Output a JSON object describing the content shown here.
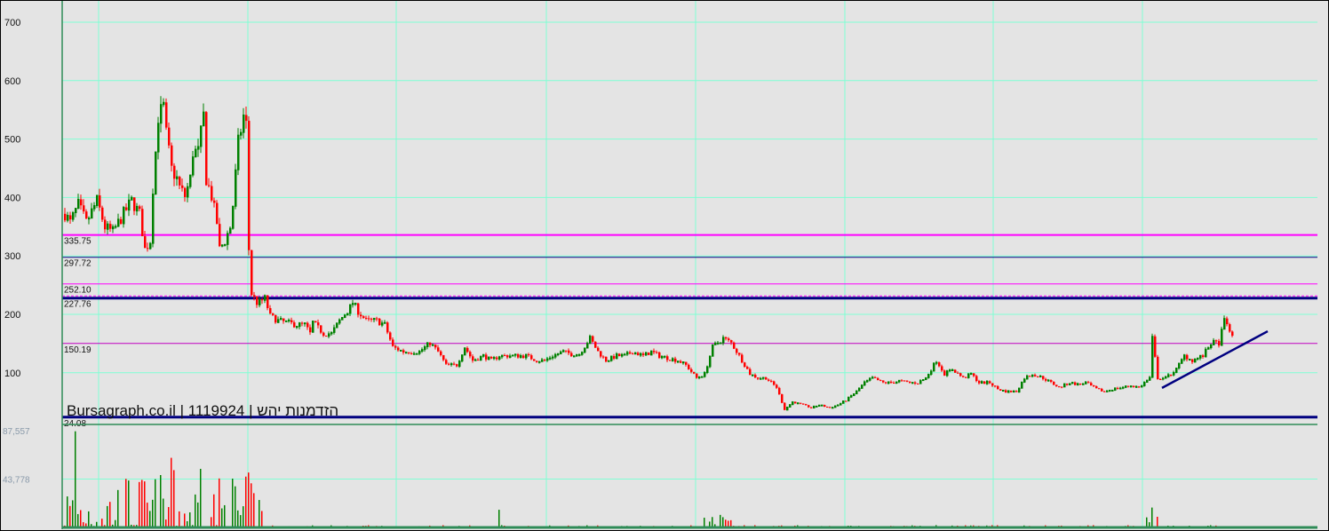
{
  "chart_data": {
    "type": "candlestick",
    "title": "Bursagraph.co.il | 1119924 | הזדמנות יהש",
    "ylim": [
      0,
      700
    ],
    "y_ticks": [
      700,
      600,
      500,
      400,
      300,
      200,
      100
    ],
    "grid": true,
    "levels": [
      {
        "value": 335.75,
        "label": "335.75",
        "color": "#ff00ff",
        "weight": "medium"
      },
      {
        "value": 297.72,
        "label": "297.72",
        "color": "#000080",
        "weight": "thin"
      },
      {
        "value": 252.1,
        "label": "252.10",
        "color": "#ff00ff",
        "weight": "thin"
      },
      {
        "value": 227.76,
        "label": "227.76",
        "color": "#000080",
        "weight": "thick"
      },
      {
        "value": 150.19,
        "label": "150.19",
        "color": "#c000c0",
        "weight": "thin"
      },
      {
        "value": 24.08,
        "label": "24.08",
        "color": "#000080",
        "weight": "thick"
      }
    ],
    "trendline": {
      "from": [
        412,
        74
      ],
      "to": [
        445,
        171
      ],
      "color": "#000080"
    },
    "price_keypoints": [
      [
        0,
        372
      ],
      [
        2,
        357
      ],
      [
        5,
        387
      ],
      [
        8,
        357
      ],
      [
        12,
        394
      ],
      [
        15,
        349
      ],
      [
        18,
        341
      ],
      [
        22,
        372
      ],
      [
        25,
        394
      ],
      [
        28,
        372
      ],
      [
        30,
        311
      ],
      [
        32,
        326
      ],
      [
        33,
        417
      ],
      [
        35,
        539
      ],
      [
        37,
        554
      ],
      [
        38,
        508
      ],
      [
        40,
        448
      ],
      [
        42,
        432
      ],
      [
        43,
        417
      ],
      [
        45,
        402
      ],
      [
        47,
        432
      ],
      [
        48,
        478
      ],
      [
        50,
        478
      ],
      [
        52,
        539
      ],
      [
        53,
        432
      ],
      [
        55,
        402
      ],
      [
        57,
        357
      ],
      [
        58,
        311
      ],
      [
        60,
        326
      ],
      [
        62,
        349
      ],
      [
        63,
        387
      ],
      [
        65,
        493
      ],
      [
        67,
        539
      ],
      [
        68,
        524
      ],
      [
        69,
        311
      ],
      [
        70,
        235
      ],
      [
        72,
        220
      ],
      [
        73,
        220
      ],
      [
        75,
        227
      ],
      [
        77,
        197
      ],
      [
        80,
        189
      ],
      [
        83,
        186
      ],
      [
        87,
        182
      ],
      [
        90,
        182
      ],
      [
        92,
        167
      ],
      [
        93,
        186
      ],
      [
        97,
        167
      ],
      [
        100,
        167
      ],
      [
        103,
        189
      ],
      [
        107,
        212
      ],
      [
        108,
        220
      ],
      [
        110,
        205
      ],
      [
        113,
        189
      ],
      [
        117,
        189
      ],
      [
        120,
        182
      ],
      [
        123,
        144
      ],
      [
        127,
        136
      ],
      [
        130,
        136
      ],
      [
        133,
        136
      ],
      [
        137,
        151
      ],
      [
        140,
        136
      ],
      [
        143,
        113
      ],
      [
        147,
        113
      ],
      [
        150,
        144
      ],
      [
        153,
        121
      ],
      [
        157,
        129
      ],
      [
        160,
        121
      ],
      [
        163,
        129
      ],
      [
        167,
        129
      ],
      [
        170,
        129
      ],
      [
        173,
        129
      ],
      [
        177,
        121
      ],
      [
        180,
        121
      ],
      [
        183,
        129
      ],
      [
        187,
        136
      ],
      [
        190,
        132
      ],
      [
        193,
        132
      ],
      [
        197,
        159
      ],
      [
        200,
        136
      ],
      [
        203,
        121
      ],
      [
        207,
        129
      ],
      [
        210,
        129
      ],
      [
        213,
        136
      ],
      [
        217,
        129
      ],
      [
        220,
        136
      ],
      [
        223,
        129
      ],
      [
        227,
        124
      ],
      [
        230,
        121
      ],
      [
        233,
        113
      ],
      [
        237,
        91
      ],
      [
        240,
        98
      ],
      [
        243,
        144
      ],
      [
        247,
        159
      ],
      [
        250,
        151
      ],
      [
        253,
        129
      ],
      [
        257,
        98
      ],
      [
        260,
        91
      ],
      [
        263,
        91
      ],
      [
        267,
        75
      ],
      [
        270,
        37
      ],
      [
        273,
        50
      ],
      [
        277,
        45
      ],
      [
        280,
        40
      ],
      [
        283,
        45
      ],
      [
        287,
        40
      ],
      [
        290,
        45
      ],
      [
        293,
        53
      ],
      [
        297,
        68
      ],
      [
        300,
        83
      ],
      [
        303,
        91
      ],
      [
        307,
        83
      ],
      [
        310,
        83
      ],
      [
        313,
        86
      ],
      [
        317,
        83
      ],
      [
        320,
        83
      ],
      [
        323,
        91
      ],
      [
        327,
        121
      ],
      [
        330,
        98
      ],
      [
        333,
        106
      ],
      [
        337,
        91
      ],
      [
        340,
        98
      ],
      [
        343,
        83
      ],
      [
        347,
        83
      ],
      [
        350,
        72
      ],
      [
        353,
        68
      ],
      [
        357,
        68
      ],
      [
        360,
        91
      ],
      [
        363,
        98
      ],
      [
        367,
        91
      ],
      [
        370,
        83
      ],
      [
        373,
        75
      ],
      [
        377,
        83
      ],
      [
        380,
        80
      ],
      [
        383,
        83
      ],
      [
        387,
        72
      ],
      [
        390,
        68
      ],
      [
        393,
        72
      ],
      [
        397,
        75
      ],
      [
        400,
        78
      ],
      [
        403,
        75
      ],
      [
        407,
        91
      ],
      [
        408,
        159
      ],
      [
        410,
        91
      ],
      [
        413,
        91
      ],
      [
        417,
        106
      ],
      [
        420,
        129
      ],
      [
        423,
        121
      ],
      [
        427,
        129
      ],
      [
        430,
        151
      ],
      [
        433,
        151
      ],
      [
        435,
        189
      ],
      [
        437,
        174
      ],
      [
        438,
        159
      ]
    ],
    "volume_axis": {
      "ticks": [
        87557,
        43778
      ],
      "tick_labels": [
        "87,557",
        "43,778"
      ],
      "max": 87557
    },
    "colors": {
      "up": "#008000",
      "down": "#ff0000",
      "grid": "#7fffd4",
      "background": "#e4e4e4"
    }
  }
}
